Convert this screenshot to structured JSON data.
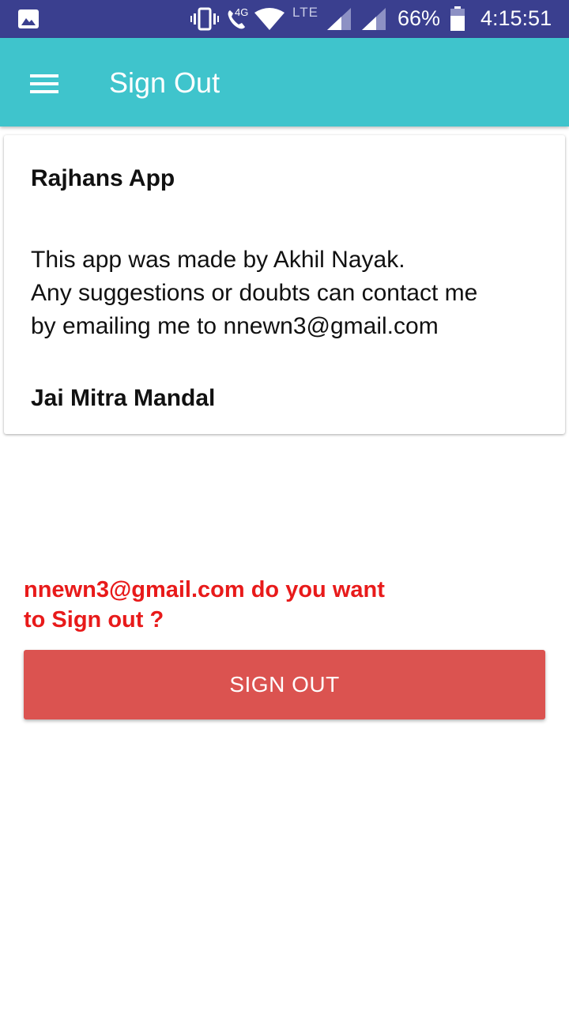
{
  "status_bar": {
    "network": "4G",
    "lte": "LTE",
    "battery": "66%",
    "time": "4:15:51",
    "icons": [
      "gallery-icon",
      "vibrate-icon",
      "call-icon",
      "wifi-icon",
      "signal-icon",
      "signal-icon",
      "battery-icon"
    ]
  },
  "app_bar": {
    "title": "Sign Out",
    "menu_icon": "menu-icon"
  },
  "card": {
    "title": "Rajhans App",
    "body_lines": [
      "This app was made by Akhil Nayak.",
      "Any suggestions or doubts can contact me",
      "by emailing me to nnewn3@gmail.com"
    ],
    "footer": "Jai Mitra Mandal"
  },
  "prompt": {
    "line1": "nnewn3@gmail.com do you want",
    "line2": "to Sign out ?"
  },
  "button": {
    "label": "SIGN OUT"
  },
  "colors": {
    "status_bar": "#3a3f8f",
    "app_bar": "#3fc4cc",
    "prompt_text": "#e81a1a",
    "button": "#db5350"
  }
}
